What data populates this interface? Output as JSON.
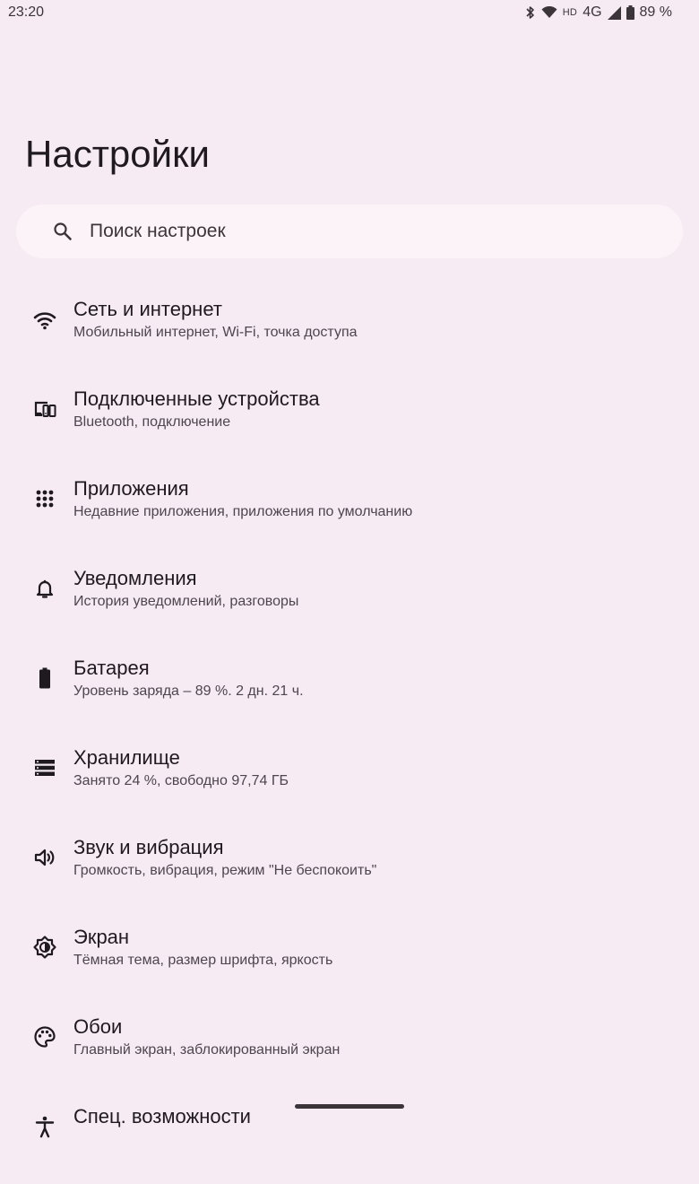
{
  "status_bar": {
    "time": "23:20",
    "hd_label": "HD",
    "network_type": "4G",
    "battery_percent": "89 %"
  },
  "page": {
    "title": "Настройки"
  },
  "search": {
    "placeholder": "Поиск настроек"
  },
  "settings": {
    "items": [
      {
        "icon": "wifi-icon",
        "title": "Сеть и интернет",
        "subtitle": "Мобильный интернет, Wi-Fi, точка доступа"
      },
      {
        "icon": "connected-devices-icon",
        "title": "Подключенные устройства",
        "subtitle": "Bluetooth, подключение"
      },
      {
        "icon": "apps-grid-icon",
        "title": "Приложения",
        "subtitle": "Недавние приложения, приложения по умолчанию"
      },
      {
        "icon": "bell-icon",
        "title": "Уведомления",
        "subtitle": "История уведомлений, разговоры"
      },
      {
        "icon": "battery-icon",
        "title": "Батарея",
        "subtitle": "Уровень заряда – 89 %. 2 дн. 21 ч."
      },
      {
        "icon": "storage-icon",
        "title": "Хранилище",
        "subtitle": "Занято 24 %, свободно 97,74 ГБ"
      },
      {
        "icon": "volume-icon",
        "title": "Звук и вибрация",
        "subtitle": "Громкость, вибрация, режим \"Не беспокоить\""
      },
      {
        "icon": "display-brightness-icon",
        "title": "Экран",
        "subtitle": "Тёмная тема, размер шрифта, яркость"
      },
      {
        "icon": "palette-icon",
        "title": "Обои",
        "subtitle": "Главный экран, заблокированный экран"
      },
      {
        "icon": "accessibility-icon",
        "title": "Спец. возможности",
        "subtitle": ""
      }
    ]
  }
}
